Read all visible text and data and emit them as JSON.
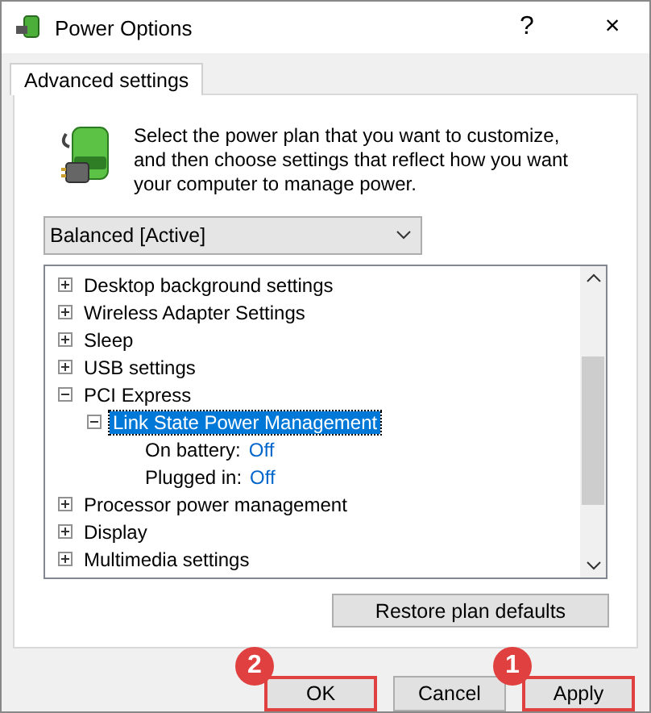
{
  "window": {
    "title": "Power Options",
    "help": "?",
    "close": "×"
  },
  "tabs": [
    {
      "label": "Advanced settings",
      "selected": true
    }
  ],
  "description": "Select the power plan that you want to customize, and then choose settings that reflect how you want your computer to manage power.",
  "plan_dropdown": {
    "value": "Balanced [Active]"
  },
  "tree": [
    {
      "kind": "group",
      "label": "Desktop background settings",
      "expanded": false,
      "selected": false
    },
    {
      "kind": "group",
      "label": "Wireless Adapter Settings",
      "expanded": false,
      "selected": false
    },
    {
      "kind": "group",
      "label": "Sleep",
      "expanded": false,
      "selected": false
    },
    {
      "kind": "group",
      "label": "USB settings",
      "expanded": false,
      "selected": false
    },
    {
      "kind": "group",
      "label": "PCI Express",
      "expanded": true,
      "selected": false,
      "children": [
        {
          "kind": "group",
          "label": "Link State Power Management",
          "expanded": true,
          "selected": true,
          "children": [
            {
              "kind": "setting",
              "label": "On battery:",
              "value": "Off",
              "selected": false
            },
            {
              "kind": "setting",
              "label": "Plugged in:",
              "value": "Off",
              "selected": false
            }
          ]
        }
      ]
    },
    {
      "kind": "group",
      "label": "Processor power management",
      "expanded": false,
      "selected": false
    },
    {
      "kind": "group",
      "label": "Display",
      "expanded": false,
      "selected": false
    },
    {
      "kind": "group",
      "label": "Multimedia settings",
      "expanded": false,
      "selected": false
    }
  ],
  "restore_button": "Restore plan defaults",
  "buttons": [
    {
      "label": "OK",
      "highlighted": true,
      "badge": "2"
    },
    {
      "label": "Cancel",
      "highlighted": false
    },
    {
      "label": "Apply",
      "highlighted": true,
      "badge": "1"
    }
  ]
}
